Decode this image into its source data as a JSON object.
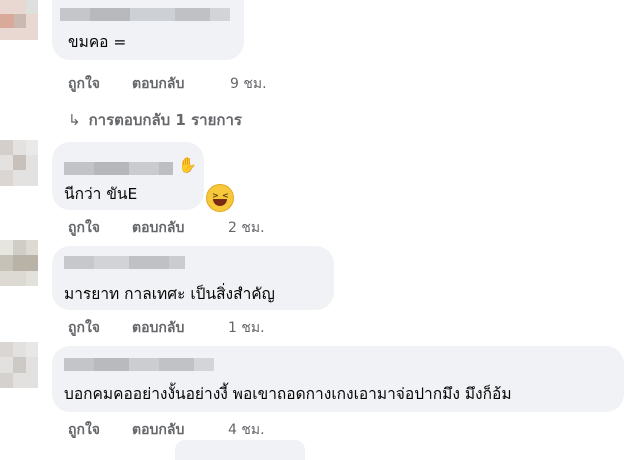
{
  "comments": [
    {
      "text": "ขมคอ =",
      "like_label": "ถูกใจ",
      "reply_label": "ตอบกลับ",
      "time": "9 ชม.",
      "replies_label": "การตอบกลับ 1 รายการ"
    },
    {
      "text": "นีกว่า ขันE",
      "like_label": "ถูกใจ",
      "reply_label": "ตอบกลับ",
      "time": "2 ชม.",
      "badge_icon": "wave-hand-icon",
      "reaction_icon": "laughing-emoji-icon"
    },
    {
      "text": "มารยาท กาลเทศะ เป็นสิ่งสำคัญ",
      "like_label": "ถูกใจ",
      "reply_label": "ตอบกลับ",
      "time": "1 ชม."
    },
    {
      "text": "บอกคมคออย่างงั้นอย่างงี้ พอเขาถอดกางเกงเอามาจ่อปากมึง มึงก็อ้ม",
      "like_label": "ถูกใจ",
      "reply_label": "ตอบกลับ",
      "time": "4 ชม."
    }
  ],
  "colors": {
    "bubble": "#f0f2f5",
    "text": "#050505",
    "secondary": "#65676b"
  }
}
